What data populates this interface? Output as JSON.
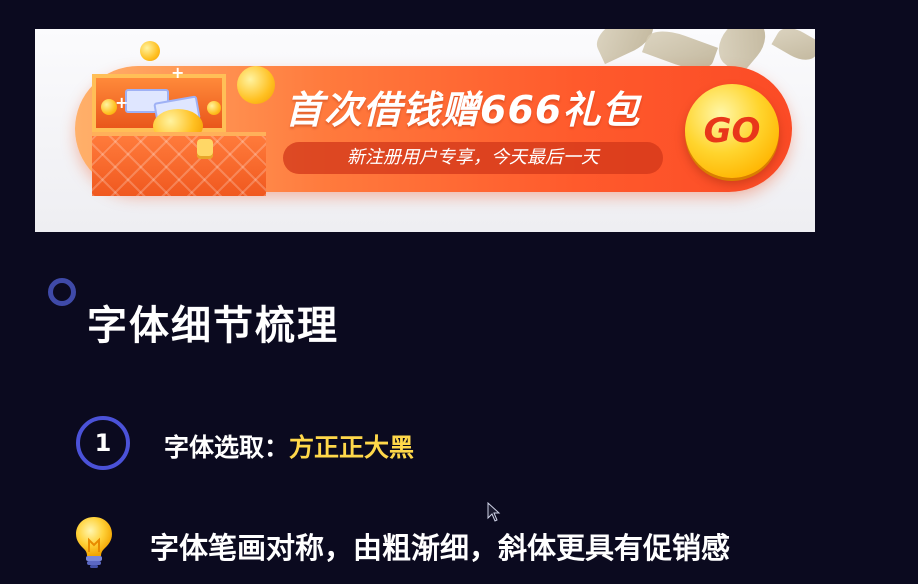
{
  "banner": {
    "headline": "首次借钱赠666礼包",
    "subline": "新注册用户专享，今天最后一天",
    "go_label": "GO",
    "colors": {
      "pill_start": "#ffb06a",
      "pill_end": "#fb4b26",
      "go_button": "#ffd52e",
      "go_text": "#e8361a"
    },
    "illustration": "treasure-chest-with-coins"
  },
  "section": {
    "title": "字体细节梳理",
    "bullet_icon": "ring-icon"
  },
  "items": [
    {
      "number": "1",
      "label": "字体选取：",
      "value": "方正正大黑"
    }
  ],
  "tip": {
    "icon": "light-bulb-icon",
    "text": "字体笔画对称，由粗渐细，斜体更具有促销感"
  },
  "colors": {
    "background": "#0b0a1f",
    "accent": "#4b52d8",
    "highlight": "#ffd84a"
  }
}
